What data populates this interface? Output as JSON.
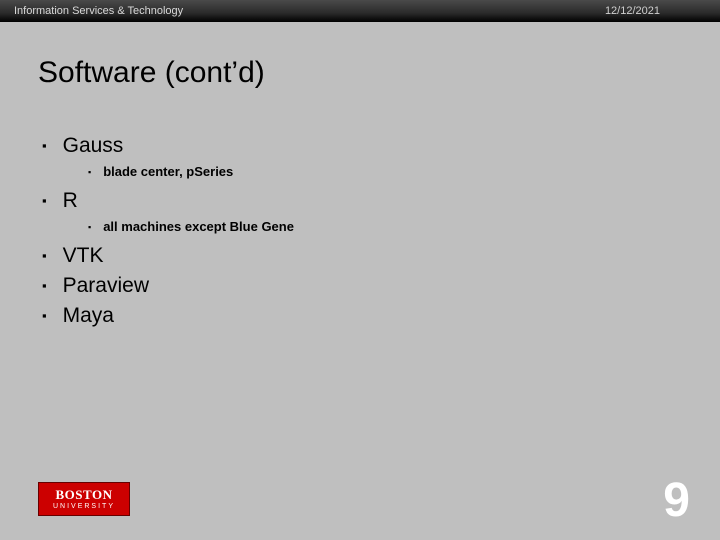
{
  "header": {
    "org": "Information Services & Technology",
    "date": "12/12/2021"
  },
  "title": "Software (cont’d)",
  "bullets": {
    "b0": "Gauss",
    "b0_sub0": "blade center, pSeries",
    "b1": "R",
    "b1_sub0": "all machines except Blue Gene",
    "b2": "VTK",
    "b3": "Paraview",
    "b4": "Maya"
  },
  "logo": {
    "line1": "BOSTON",
    "line2": "UNIVERSITY"
  },
  "page_number": "9"
}
